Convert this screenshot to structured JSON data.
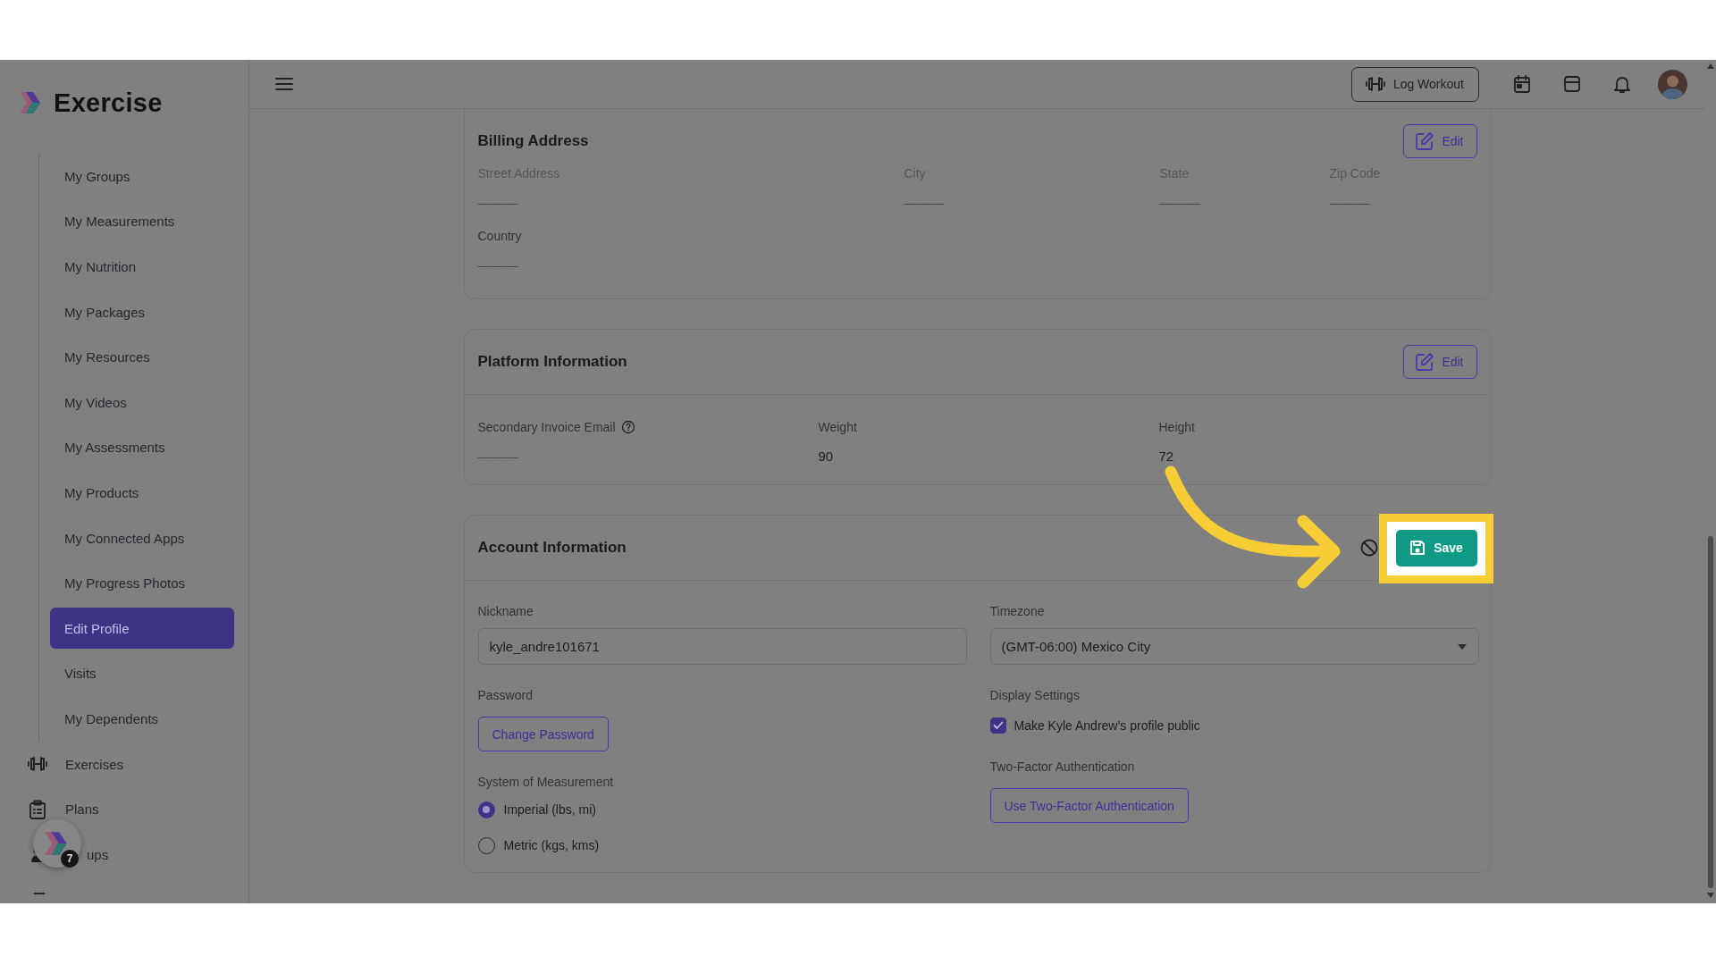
{
  "sidebar": {
    "logo": "Exercise",
    "sub_items": [
      {
        "label": "My Groups",
        "selected": false
      },
      {
        "label": "My Measurements",
        "selected": false
      },
      {
        "label": "My Nutrition",
        "selected": false
      },
      {
        "label": "My Packages",
        "selected": false
      },
      {
        "label": "My Resources",
        "selected": false
      },
      {
        "label": "My Videos",
        "selected": false
      },
      {
        "label": "My Assessments",
        "selected": false
      },
      {
        "label": "My Products",
        "selected": false
      },
      {
        "label": "My Connected Apps",
        "selected": false
      },
      {
        "label": "My Progress Photos",
        "selected": false
      },
      {
        "label": "Edit Profile",
        "selected": true
      },
      {
        "label": "Visits",
        "selected": false
      },
      {
        "label": "My Dependents",
        "selected": false
      }
    ],
    "items": [
      {
        "label": "Exercises",
        "kind": "dumbbell"
      },
      {
        "label": "Plans",
        "kind": "clipboard"
      },
      {
        "label": "ups",
        "kind": "people"
      }
    ]
  },
  "launcher": {
    "badge": "7"
  },
  "topbar": {
    "log_workout": "Log Workout"
  },
  "billing": {
    "title": "Billing Address",
    "edit": "Edit",
    "fields": [
      {
        "label": "Street Address",
        "value": "———"
      },
      {
        "label": "City",
        "value": "———"
      },
      {
        "label": "State",
        "value": "———"
      },
      {
        "label": "Zip Code",
        "value": "———"
      },
      {
        "label": "Country",
        "value": "———"
      }
    ]
  },
  "platform": {
    "title": "Platform Information",
    "edit": "Edit",
    "fields": [
      {
        "label": "Secondary Invoice Email",
        "help": true,
        "value": "———"
      },
      {
        "label": "Weight",
        "help": false,
        "value": "90"
      },
      {
        "label": "Height",
        "help": false,
        "value": "72"
      }
    ]
  },
  "account": {
    "title": "Account Information",
    "save": "Save",
    "nickname": {
      "label": "Nickname",
      "value": "kyle_andre101671"
    },
    "timezone": {
      "label": "Timezone",
      "value": "(GMT-06:00) Mexico City"
    },
    "password": {
      "label": "Password",
      "button": "Change Password"
    },
    "display": {
      "label": "Display Settings",
      "option": "Make Kyle Andrew’s profile public",
      "checked": true
    },
    "measurement": {
      "label": "System of Measurement",
      "options": [
        {
          "label": "Imperial (lbs, mi)",
          "selected": true
        },
        {
          "label": "Metric (kgs, kms)",
          "selected": false
        }
      ]
    },
    "two_factor": {
      "label": "Two-Factor Authentication",
      "button": "Use Two-Factor Authentication"
    }
  }
}
